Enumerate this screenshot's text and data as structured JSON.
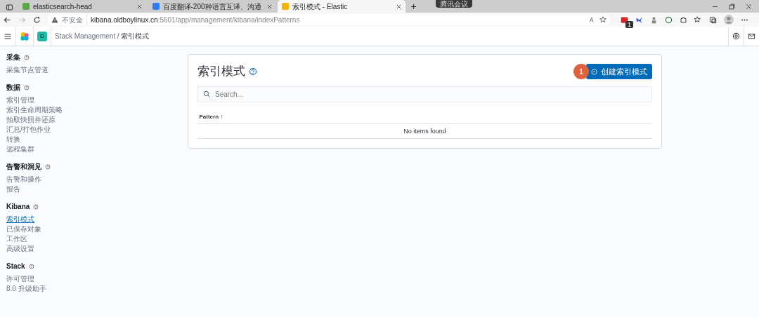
{
  "browser": {
    "tabs": [
      {
        "title": "elasticsearch-head",
        "selected": false
      },
      {
        "title": "百度翻译-200种语言互译、沟通",
        "selected": false
      },
      {
        "title": "索引模式 - Elastic",
        "selected": true
      }
    ],
    "new_tab": "+",
    "meeting_overlay": "腾讯会议",
    "address": {
      "security": "不安全",
      "host": "kibana.oldboylinux.cn",
      "path": ":5601/app/management/kibana/indexPatterns"
    },
    "extension_badge": "1"
  },
  "header": {
    "space_avatar": "D",
    "breadcrumbs": [
      "Stack Management",
      "索引模式"
    ],
    "breadcrumb_separator": "/"
  },
  "sidebar": {
    "sections": [
      {
        "title": "采集",
        "items": [
          {
            "label": "采集节点管道",
            "selected": false
          }
        ]
      },
      {
        "title": "数据",
        "items": [
          {
            "label": "索引管理",
            "selected": false
          },
          {
            "label": "索引生命周期策略",
            "selected": false
          },
          {
            "label": "拍取快照并还原",
            "selected": false
          },
          {
            "label": "汇总/打包作业",
            "selected": false
          },
          {
            "label": "转换",
            "selected": false
          },
          {
            "label": "远程集群",
            "selected": false
          }
        ]
      },
      {
        "title": "告警和洞见",
        "items": [
          {
            "label": "告警和操作",
            "selected": false
          },
          {
            "label": "报告",
            "selected": false
          }
        ]
      },
      {
        "title": "Kibana",
        "items": [
          {
            "label": "索引模式",
            "selected": true
          },
          {
            "label": "已保存对象",
            "selected": false
          },
          {
            "label": "工作区",
            "selected": false
          },
          {
            "label": "高级设置",
            "selected": false
          }
        ]
      },
      {
        "title": "Stack",
        "items": [
          {
            "label": "许可管理",
            "selected": false
          },
          {
            "label": "8.0 升级助手",
            "selected": false
          }
        ]
      }
    ]
  },
  "page": {
    "title": "索引模式",
    "step_badge": "1",
    "create_button": "创建索引模式",
    "search": {
      "placeholder": "Search..."
    },
    "table": {
      "columns": [
        {
          "label": "Pattern",
          "sort": "↑"
        }
      ],
      "empty_message": "No items found"
    }
  }
}
